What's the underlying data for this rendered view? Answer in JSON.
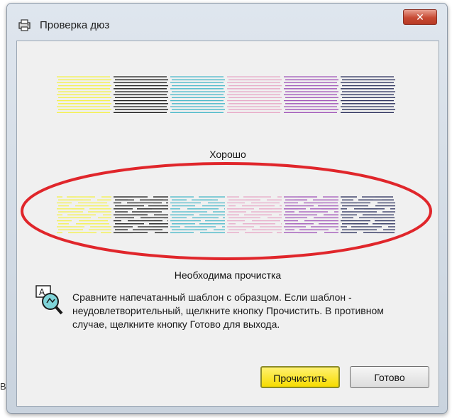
{
  "window": {
    "title": "Проверка дюз",
    "close_label": "✕"
  },
  "patterns": {
    "colors": [
      "#f4f14a",
      "#1a1a1a",
      "#49b8c9",
      "#e7a8c7",
      "#a055b8",
      "#2a2f5c"
    ],
    "good_caption": "Хорошо",
    "bad_caption": "Необходима прочистка"
  },
  "message": "Сравните напечатанный шаблон с образцом. Если шаблон - неудовлетворительный, щелкните кнопку Прочистить. В противном случае, щелкните кнопку Готово для выхода.",
  "buttons": {
    "clean": "Прочистить",
    "done": "Готово"
  },
  "side_letter": "В",
  "annotation_color": "#e0262b"
}
